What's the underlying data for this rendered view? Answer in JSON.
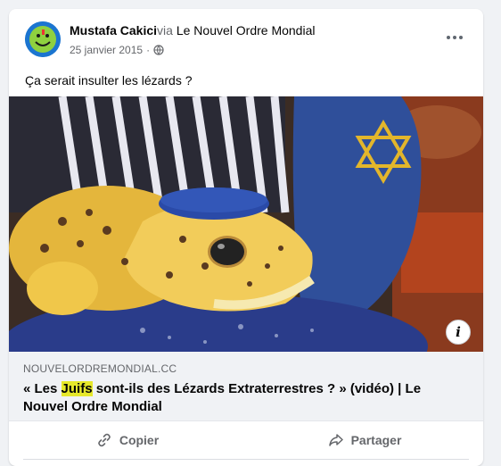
{
  "post": {
    "author": "Mustafa Cakici",
    "via_prefix": "via ",
    "via_page": "Le Nouvel Ordre Mondial",
    "date": "25 janvier 2015",
    "separator": "·",
    "privacy_icon": "globe-icon",
    "text": "Ça serait insulter les lézards ?"
  },
  "link": {
    "domain": "NOUVELORDREMONDIAL.CC",
    "title_prefix": "« Les ",
    "title_highlight": "Juifs",
    "title_suffix": " sont-ils des Lézards Extraterrestres ? » (vidéo) | Le Nouvel Ordre Mondial",
    "info_label": "i"
  },
  "actions": {
    "copy_label": "Copier",
    "share_label": "Partager"
  },
  "colors": {
    "highlight": "#e6e82a",
    "secondary_text": "#65676b",
    "card_bg": "#ffffff",
    "page_bg": "#f0f2f5"
  }
}
